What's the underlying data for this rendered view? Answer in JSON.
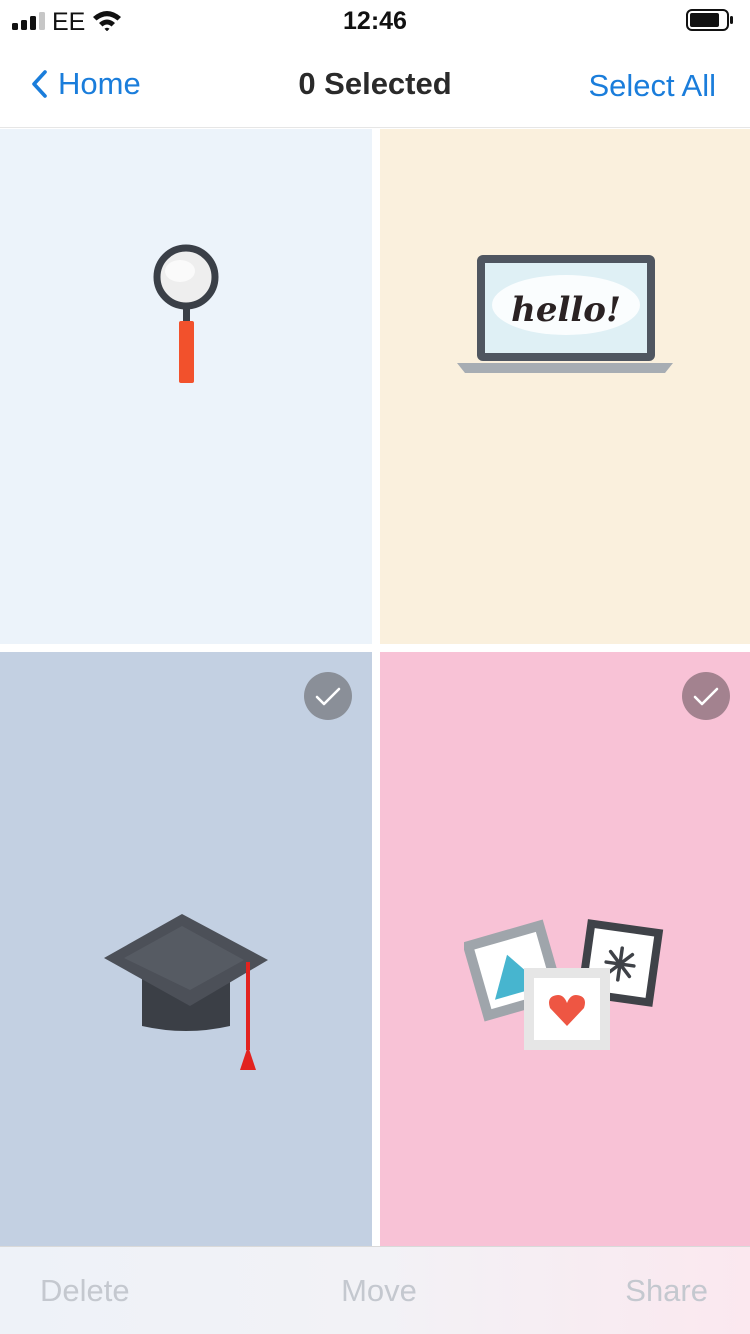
{
  "status_bar": {
    "carrier": "EE",
    "time": "12:46",
    "signal_bars_filled": 3,
    "signal_bars_total": 4,
    "icons": [
      "signal-icon",
      "wifi-icon",
      "battery-icon"
    ]
  },
  "nav": {
    "back_label": "Home",
    "title": "0 Selected",
    "select_all_label": "Select All"
  },
  "tiles": [
    {
      "name": "magnifier",
      "background": "#ecf3fa",
      "checked": false
    },
    {
      "name": "laptop",
      "background": "#faf0dd",
      "checked": false,
      "screen_text": "hello!"
    },
    {
      "name": "graduation-cap",
      "background": "#c3d0e2",
      "checked": true,
      "checkmark_color": "#8a8f98"
    },
    {
      "name": "photo-frames",
      "background": "#f8c2d6",
      "checked": true,
      "checkmark_color": "#a3828f"
    }
  ],
  "toolbar": {
    "delete_label": "Delete",
    "move_label": "Move",
    "share_label": "Share",
    "disabled_color": "#c4c8cf"
  },
  "colors": {
    "accent": "#1a7ddb",
    "title": "#2a2a2a"
  }
}
